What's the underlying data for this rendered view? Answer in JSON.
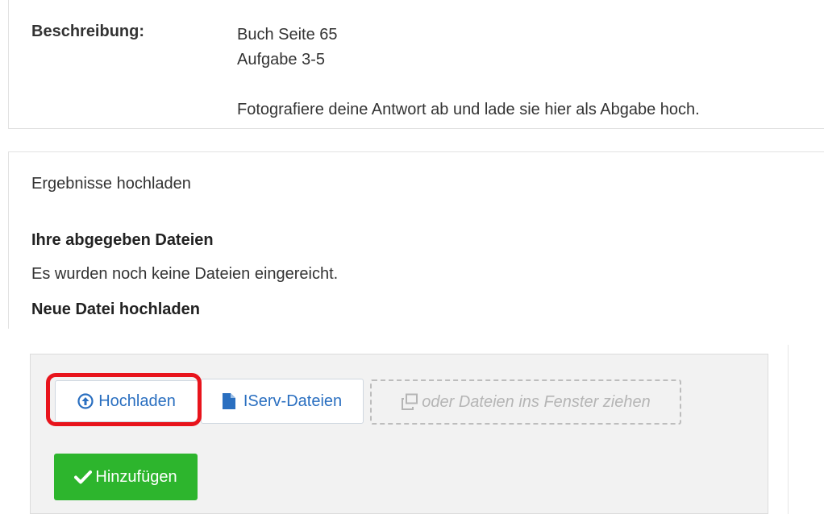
{
  "assignment": {
    "description_label": "Beschreibung:",
    "description_lines": [
      "Buch Seite 65",
      "Aufgabe 3-5",
      "Fotografiere deine Antwort ab und lade sie hier als Abgabe hoch."
    ]
  },
  "upload": {
    "section_title": "Ergebnisse hochladen",
    "submitted_heading": "Ihre abgegeben Dateien",
    "submitted_empty": "Es wurden noch keine Dateien eingereicht.",
    "new_heading": "Neue Datei hochladen",
    "upload_button": {
      "label": "Hochladen",
      "icon": "upload-circle-icon"
    },
    "iserv_button": {
      "label": "IServ-Dateien",
      "icon": "file-icon"
    },
    "drop_hint": {
      "label": "oder Dateien ins Fenster ziehen",
      "icon": "copy-windows-icon"
    },
    "add_button": {
      "label": "Hinzufügen",
      "icon": "check-icon"
    }
  },
  "colors": {
    "accent": "#2a6fc0",
    "add_green": "#2db52d",
    "highlight_red": "#e8141c",
    "panel_bg": "#f2f2f2"
  }
}
